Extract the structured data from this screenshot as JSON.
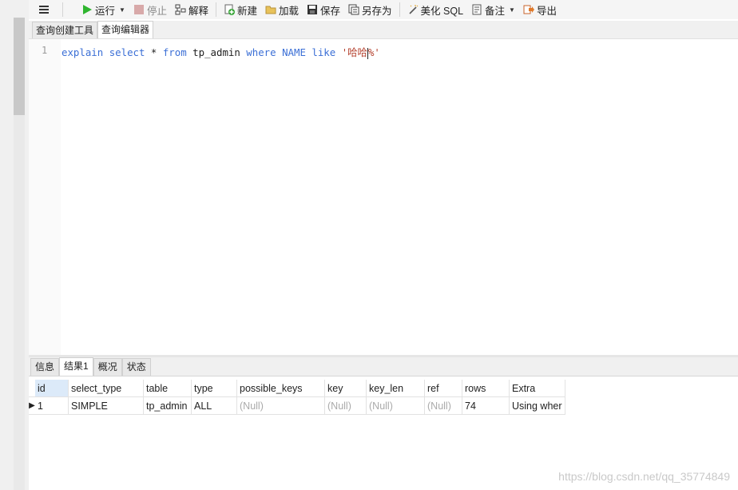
{
  "toolbar": {
    "menu_icon": "hamburger-icon",
    "run": "运行",
    "stop": "停止",
    "explain": "解释",
    "new": "新建",
    "load": "加载",
    "save": "保存",
    "save_as": "另存为",
    "beautify": "美化 SQL",
    "comment": "备注",
    "export": "导出"
  },
  "query_tabs": [
    "查询创建工具",
    "查询编辑器"
  ],
  "editor": {
    "line_number": "1",
    "tokens": {
      "explain": "explain",
      "select": "select",
      "star": " * ",
      "from": "from",
      "table": " tp_admin ",
      "where": "where",
      "name": "NAME",
      "like": "like",
      "str_a": "'哈哈",
      "str_b": "%'"
    }
  },
  "result_tabs": [
    "信息",
    "结果1",
    "概况",
    "状态"
  ],
  "result": {
    "columns": [
      "id",
      "select_type",
      "table",
      "type",
      "possible_keys",
      "key",
      "key_len",
      "ref",
      "rows",
      "Extra"
    ],
    "row": [
      "1",
      "SIMPLE",
      "tp_admin",
      "ALL",
      "(Null)",
      "(Null)",
      "(Null)",
      "(Null)",
      "74",
      "Using wher"
    ]
  },
  "watermark": "https://blog.csdn.net/qq_35774849",
  "colors": {
    "keyword": "#3b6fd6",
    "string": "#b5422f",
    "run_green": "#2fb52f"
  }
}
